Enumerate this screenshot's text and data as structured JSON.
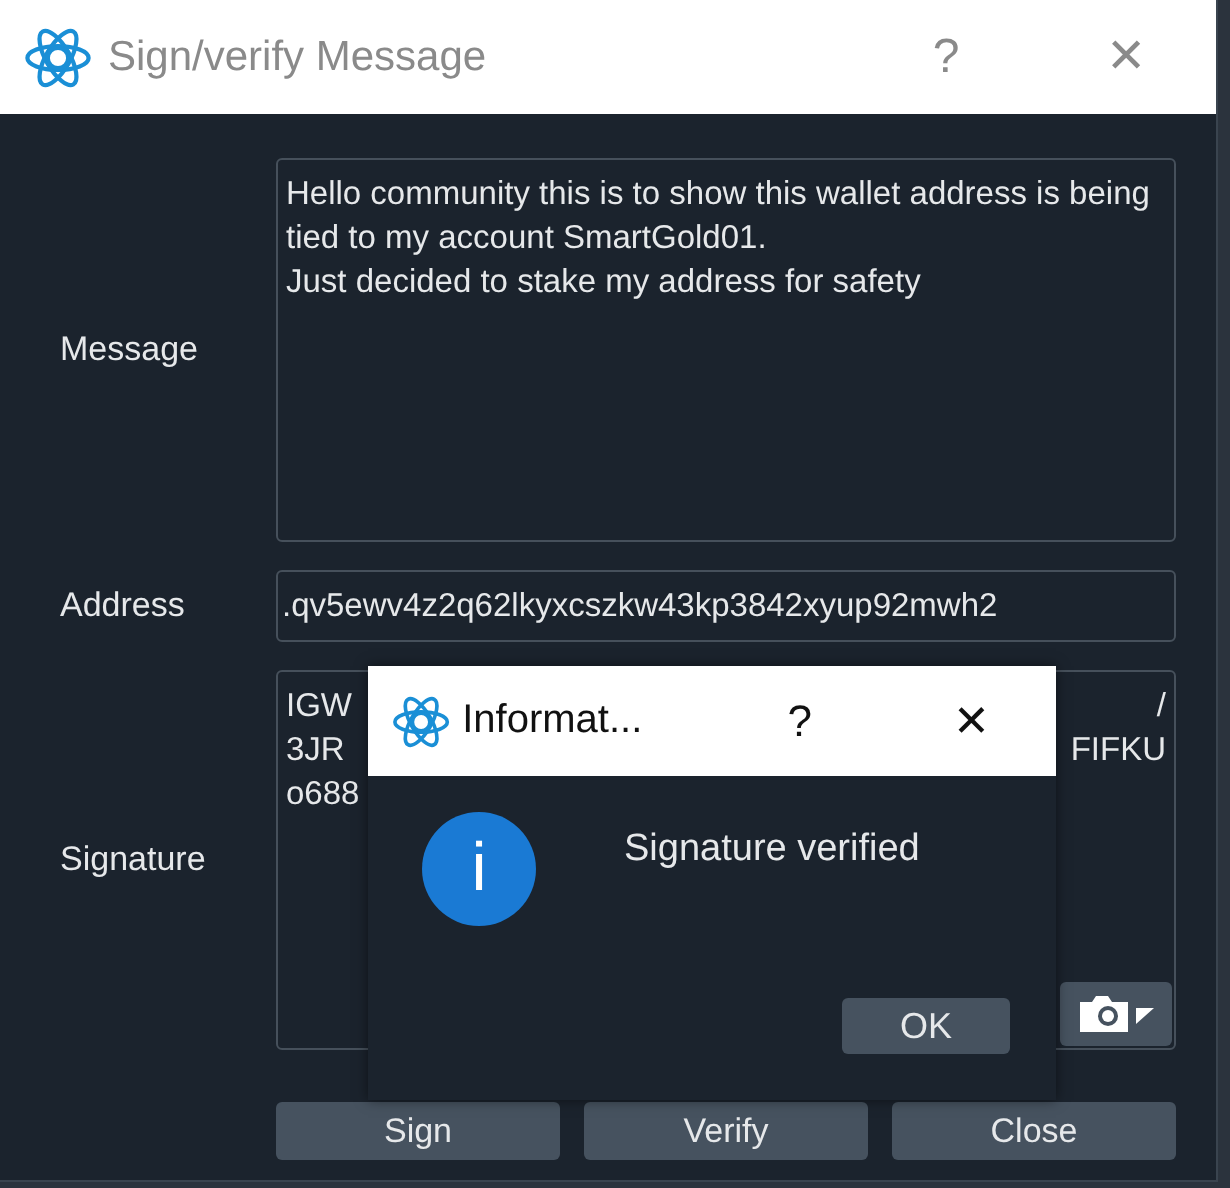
{
  "window": {
    "title": "Sign/verify Message",
    "help": "?",
    "close": "✕"
  },
  "fields": [
    {
      "kind": "area",
      "label": "Message",
      "value": "Hello community this is to show this wallet address is being tied to my account SmartGold01.\nJust decided to stake my address for safety"
    },
    {
      "kind": "line",
      "label": "Address",
      "value": ".qv5ewv4z2q62lkyxcszkw43kp3842xyup92mwh2"
    },
    {
      "kind": "signature",
      "label": "Signature",
      "left": [
        "IGW",
        "3JR",
        "o688"
      ],
      "right": [
        "/",
        "FIFKU"
      ]
    }
  ],
  "buttons": [
    "Sign",
    "Verify",
    "Close"
  ],
  "dialog": {
    "title": "Informat...",
    "help": "?",
    "close": "✕",
    "icon": "i",
    "message": "Signature verified",
    "button": "OK"
  }
}
